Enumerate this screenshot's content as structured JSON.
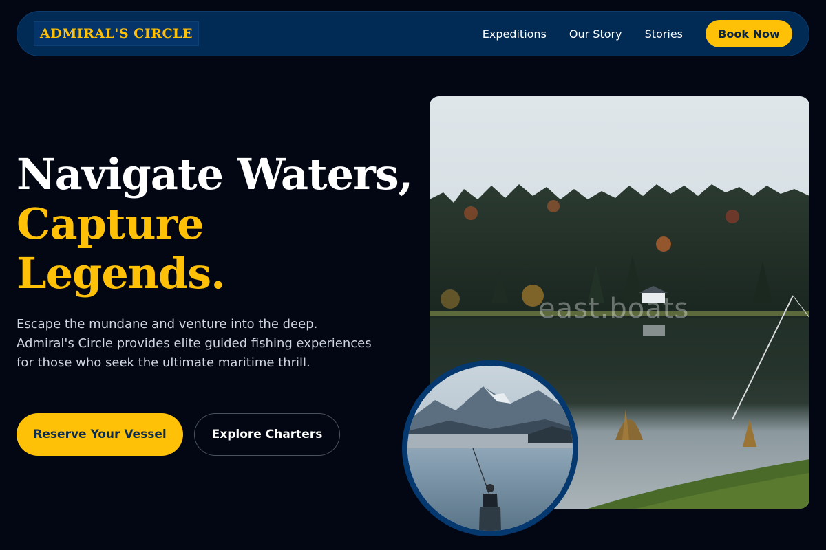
{
  "brand": {
    "logo_text": "ADMIRAL'S CIRCLE"
  },
  "nav": {
    "links": [
      {
        "label": "Expeditions"
      },
      {
        "label": "Our Story"
      },
      {
        "label": "Stories"
      }
    ],
    "cta_label": "Book Now"
  },
  "hero": {
    "headline_line1": "Navigate Waters,",
    "headline_line2": "Capture",
    "headline_line3": "Legends.",
    "description": "Escape the mundane and venture into the deep. Admiral's Circle provides elite guided fishing experiences for those who seek the ultimate maritime thrill.",
    "primary_button": "Reserve Your Vessel",
    "secondary_button": "Explore Charters"
  },
  "images": {
    "main_watermark": "east.boats",
    "main_photo_subject": "lake-forest-cabin-with-fishing-rod",
    "inset_photo_subject": "angler-fishing-misty-mountain-lake"
  },
  "colors": {
    "background": "#020713",
    "navbar": "#012a55",
    "accent_gold": "#ffc107",
    "inset_border": "#05386e"
  }
}
